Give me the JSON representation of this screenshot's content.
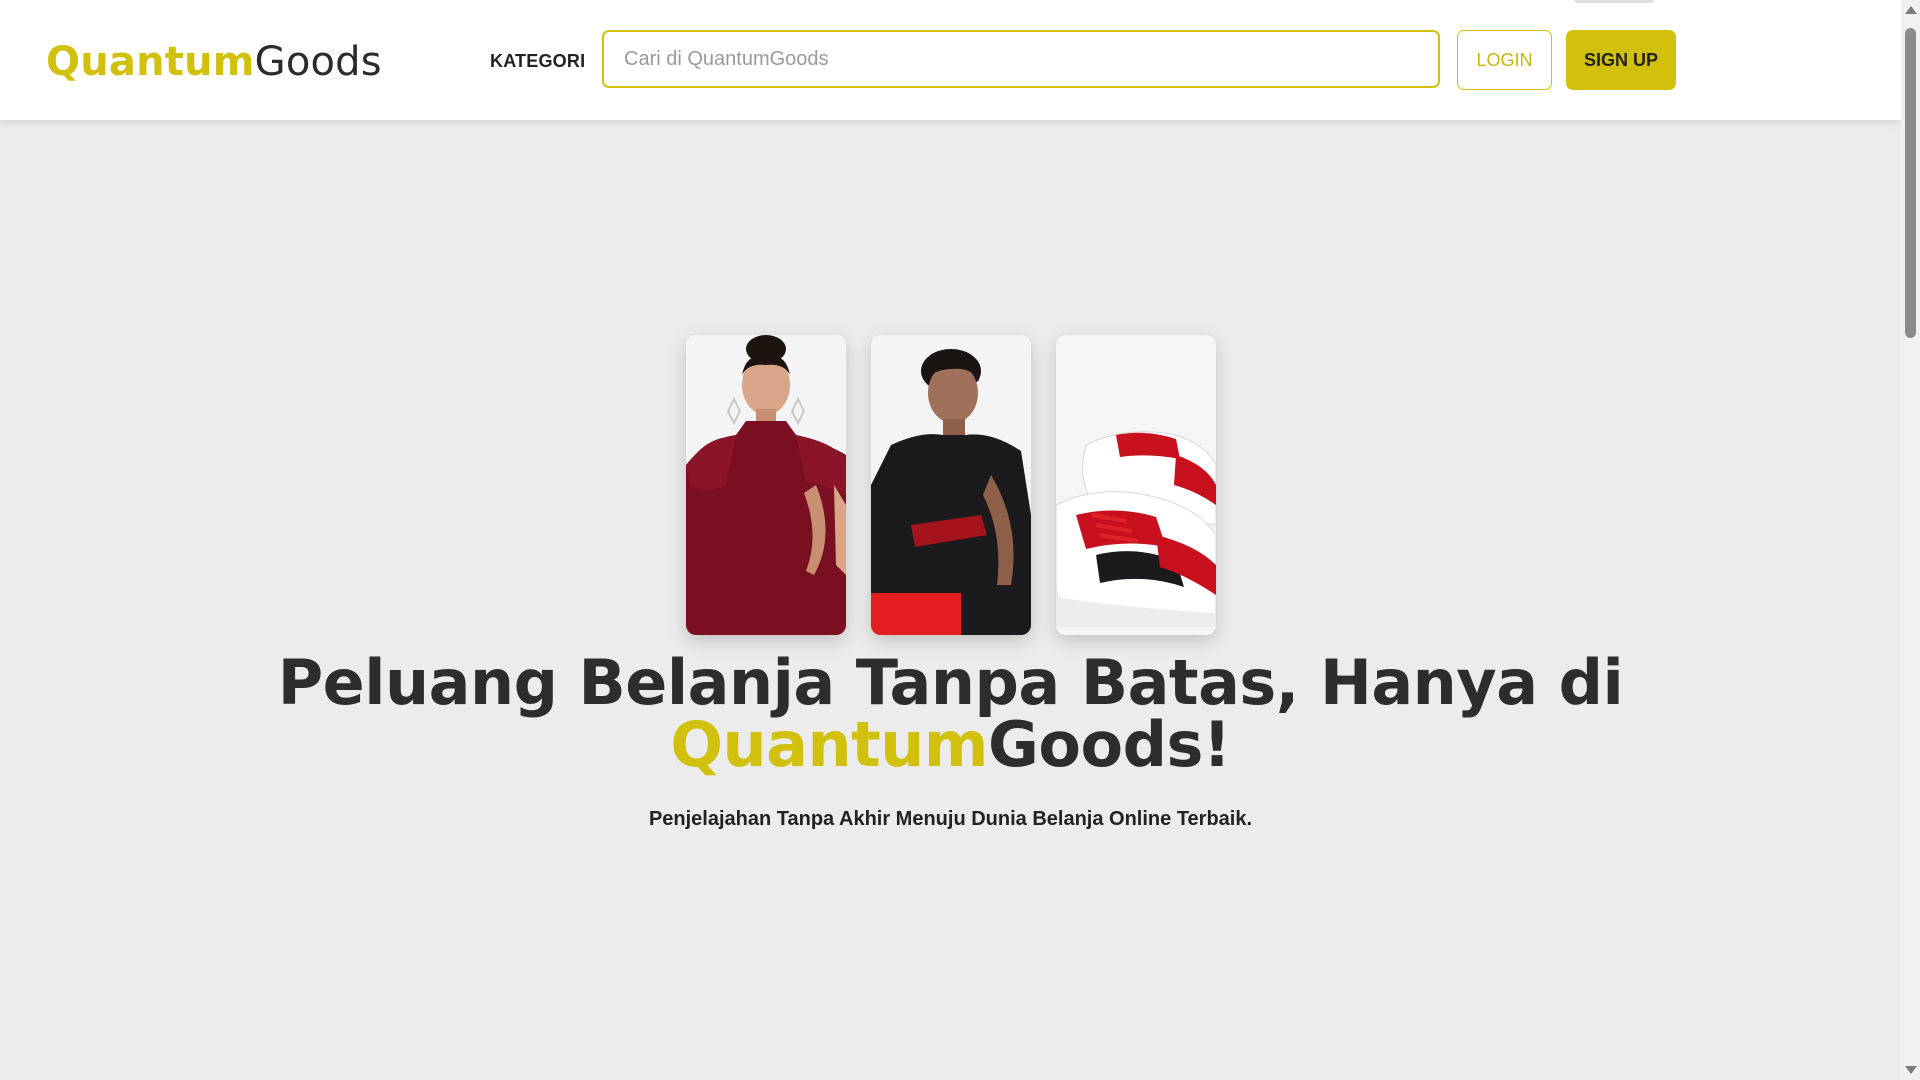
{
  "header": {
    "logo_part1": "Quantum",
    "logo_part2": "Goods",
    "kategori_label": "KATEGORI",
    "search_placeholder": "Cari di QuantumGoods",
    "login_label": "LOGIN",
    "signup_label": "SIGN UP"
  },
  "hero": {
    "title_line1": "Peluang Belanja Tanpa Batas, Hanya di",
    "title_brand_a": "Quantum",
    "title_brand_b": "Goods!",
    "subtitle": "Penjelajahan Tanpa Akhir Menuju Dunia Belanja Online Terbaik.",
    "images": [
      {
        "icon": "woman-red-dress-image"
      },
      {
        "icon": "man-black-tshirt-image"
      },
      {
        "icon": "red-sneakers-image"
      }
    ]
  },
  "colors": {
    "accent": "#d1c10c",
    "background": "#ececec",
    "text": "#2b2b2b"
  }
}
